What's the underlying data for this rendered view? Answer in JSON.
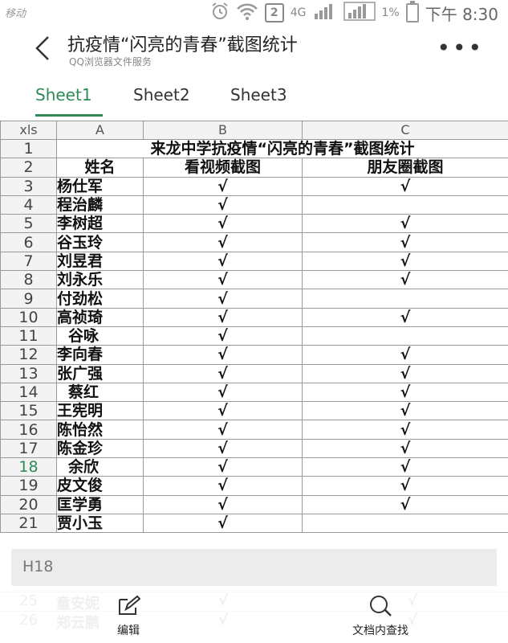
{
  "status_bar": {
    "carrier": "移动",
    "network": "4G",
    "sim": "2",
    "battery": "1%",
    "time": "下午 8:30"
  },
  "header": {
    "title": "抗疫情“闪亮的青春”截图统计",
    "subtitle": "QQ浏览器文件服务"
  },
  "tabs": [
    {
      "label": "Sheet1"
    },
    {
      "label": "Sheet2"
    },
    {
      "label": "Sheet3"
    }
  ],
  "sheet": {
    "corner": "xls",
    "columns": [
      "A",
      "B",
      "C"
    ],
    "title_row": {
      "num": "1",
      "text": "来龙中学抗疫情“闪亮的青春”截图统计"
    },
    "header_row": {
      "num": "2",
      "a": "姓名",
      "b": "看视频截图",
      "c": "朋友圈截图"
    },
    "check_mark": "√",
    "rows": [
      {
        "num": "3",
        "name": "杨仕军",
        "b": "√",
        "c": "√"
      },
      {
        "num": "4",
        "name": "程治麟",
        "b": "√",
        "c": ""
      },
      {
        "num": "5",
        "name": "李树超",
        "b": "√",
        "c": "√"
      },
      {
        "num": "6",
        "name": "谷玉玲",
        "b": "√",
        "c": "√"
      },
      {
        "num": "7",
        "name": "刘昱君",
        "b": "√",
        "c": "√"
      },
      {
        "num": "8",
        "name": "刘永乐",
        "b": "√",
        "c": "√"
      },
      {
        "num": "9",
        "name": "付劲松",
        "b": "√",
        "c": ""
      },
      {
        "num": "10",
        "name": "高祯琦",
        "b": "√",
        "c": "√"
      },
      {
        "num": "11",
        "name": "谷咏",
        "b": "√",
        "c": ""
      },
      {
        "num": "12",
        "name": "李向春",
        "b": "√",
        "c": "√"
      },
      {
        "num": "13",
        "name": "张广强",
        "b": "√",
        "c": "√"
      },
      {
        "num": "14",
        "name": "蔡红",
        "b": "√",
        "c": "√"
      },
      {
        "num": "15",
        "name": "王宪明",
        "b": "√",
        "c": "√"
      },
      {
        "num": "16",
        "name": "陈怡然",
        "b": "√",
        "c": "√"
      },
      {
        "num": "17",
        "name": "陈金珍",
        "b": "√",
        "c": "√"
      },
      {
        "num": "18",
        "name": "余欣",
        "b": "√",
        "c": "√"
      },
      {
        "num": "19",
        "name": "皮文俊",
        "b": "√",
        "c": "√"
      },
      {
        "num": "20",
        "name": "匡学勇",
        "b": "√",
        "c": "√"
      },
      {
        "num": "21",
        "name": "贾小玉",
        "b": "√",
        "c": ""
      }
    ],
    "selected_row": "18",
    "ghost_rows": [
      {
        "num": "25",
        "name": "童安妮"
      },
      {
        "num": "26",
        "name": "郑云鹏"
      }
    ]
  },
  "cell_ref": "H18",
  "toolbar": {
    "edit_label": "编辑",
    "find_label": "文档内查找"
  }
}
